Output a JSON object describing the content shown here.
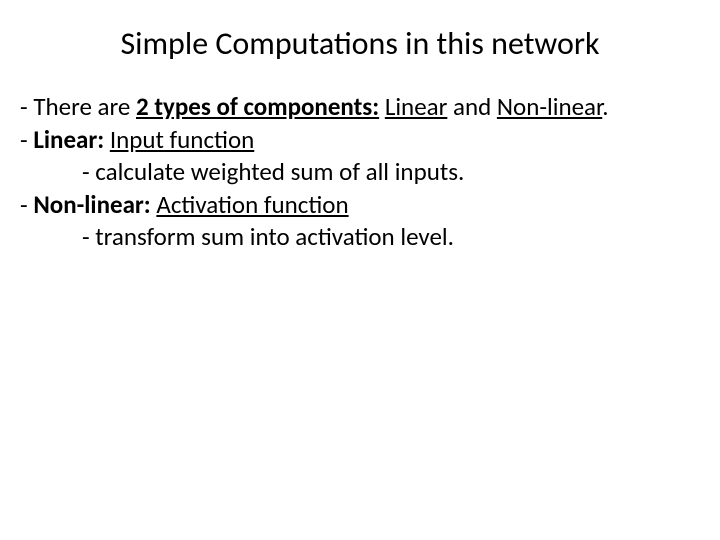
{
  "title": "Simple Computations in this network",
  "lines": {
    "l1_dash": "- ",
    "l1_a": "There are ",
    "l1_b": "2 types of components:",
    "l1_c": " ",
    "l1_d": "Linear",
    "l1_e": " and ",
    "l1_f": "Non-linear",
    "l1_g": ".",
    "l2_dash": "- ",
    "l2_a": "Linear:",
    "l2_b": " ",
    "l2_c": "Input function",
    "l3": "- calculate weighted sum of all inputs.",
    "l4_dash": "- ",
    "l4_a": "Non-linear:",
    "l4_b": " ",
    "l4_c": "Activation function",
    "l5": "- transform sum into activation level."
  }
}
